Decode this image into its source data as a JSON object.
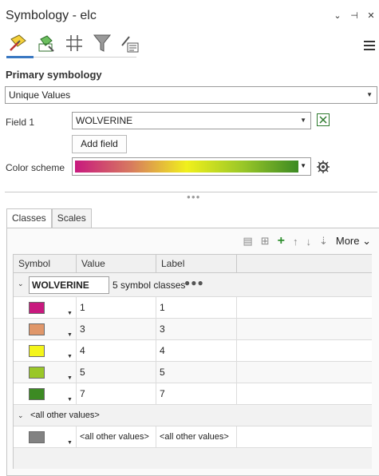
{
  "title": "Symbology - elc",
  "window": {
    "pin_icon": "pin-icon",
    "close_icon": "close-icon",
    "dropdown_icon": "chevron-down-icon",
    "menu_icon": "menu-icon"
  },
  "toolbar": [
    "primary-symbology-icon",
    "vary-symbology-icon",
    "symbol-layers-icon",
    "filter-icon",
    "label-classes-icon"
  ],
  "primary": {
    "section_label": "Primary symbology",
    "renderer": "Unique Values",
    "field1_label": "Field 1",
    "field1_value": "WOLVERINE",
    "add_field_label": "Add field",
    "color_scheme_label": "Color scheme",
    "color_scheme_colors": [
      "#c8197e",
      "#d77a5f",
      "#f0f01c",
      "#9ac728",
      "#3c8a23"
    ]
  },
  "tabs": [
    "Classes",
    "Scales"
  ],
  "actions": {
    "more_label": "More"
  },
  "grid": {
    "headers": [
      "Symbol",
      "Value",
      "Label"
    ],
    "group": {
      "name": "WOLVERINE",
      "count": "5 symbol classes",
      "dots": "●●●"
    },
    "rows": [
      {
        "color": "#c8197e",
        "value": "1",
        "label": "1"
      },
      {
        "color": "#e0976a",
        "value": "3",
        "label": "3"
      },
      {
        "color": "#f4f51a",
        "value": "4",
        "label": "4"
      },
      {
        "color": "#9ac728",
        "value": "5",
        "label": "5"
      },
      {
        "color": "#3c8a23",
        "value": "7",
        "label": "7"
      }
    ],
    "other": {
      "header": "<all other values>",
      "color": "#828282",
      "value": "<all other values>",
      "label": "<all other values>"
    }
  }
}
